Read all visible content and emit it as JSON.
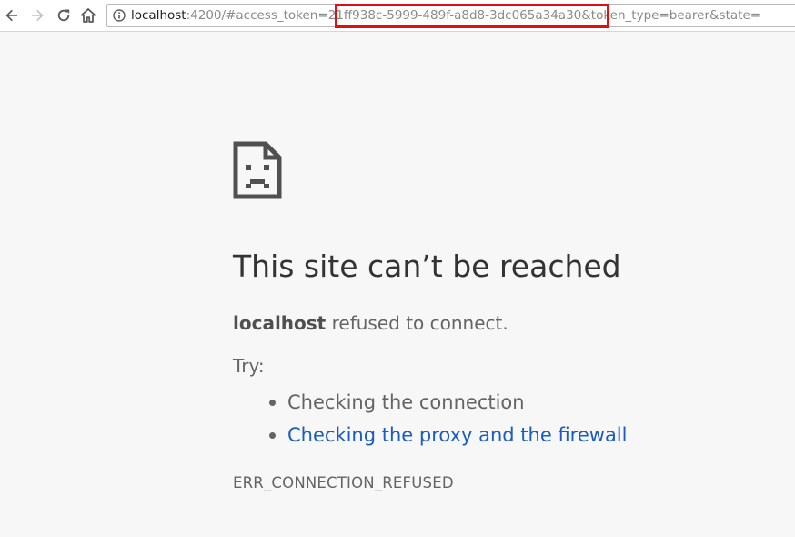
{
  "browser": {
    "url": {
      "host": "localhost",
      "rest_before_token": ":4200/#access_token=",
      "token": "21ff938c-5999-489f-a8d8-3dc065a34a30",
      "rest_after_token": "&token_type=bearer&state="
    },
    "highlight_color": "#e01010",
    "icons": {
      "back": "back-arrow-icon",
      "forward": "forward-arrow-icon",
      "reload": "reload-icon",
      "home": "home-icon",
      "info": "info-icon"
    }
  },
  "error_page": {
    "icon": "sad-page-icon",
    "headline": "This site can’t be reached",
    "description": {
      "host": "localhost",
      "message": " refused to connect."
    },
    "try_label": "Try:",
    "suggestions": [
      {
        "text": "Checking the connection",
        "is_link": false
      },
      {
        "text": "Checking the proxy and the firewall",
        "is_link": true
      }
    ],
    "link_color": "#1a5dc0",
    "error_code": "ERR_CONNECTION_REFUSED"
  }
}
